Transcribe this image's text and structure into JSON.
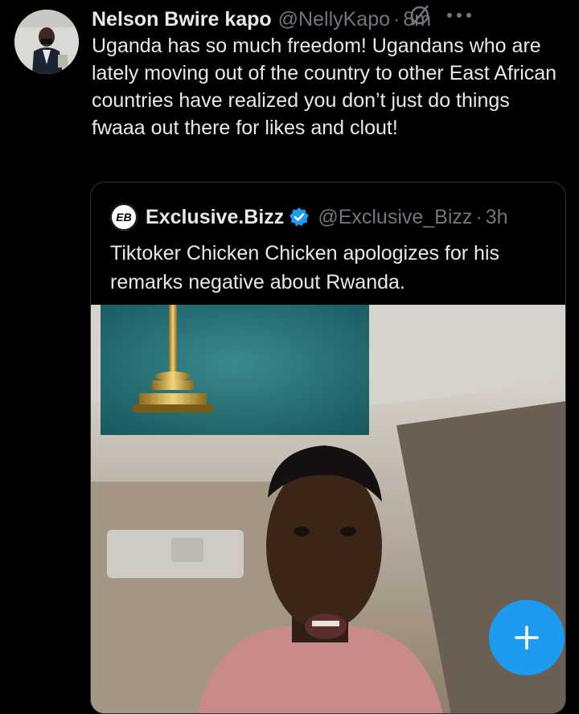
{
  "tweet": {
    "author_name": "Nelson Bwire kapo",
    "handle": "@NellyKapo",
    "separator": "·",
    "time": "8m",
    "text": "Uganda has so much freedom! Ugandans who are lately moving out of the country to other East African countries have realized you don’t just do things fwaaa out there for likes and clout!",
    "avatar_icon": "profile-photo-icon",
    "grok_icon": "grok-icon",
    "more_icon": "more-horizontal-icon"
  },
  "quote": {
    "author_name": "Exclusive.Bizz",
    "handle": "@Exclusive_Bizz",
    "separator": "·",
    "time": "3h",
    "text": "Tiktoker Chicken Chicken apologizes for his remarks negative about Rwanda.",
    "logo_text": "EB",
    "verified_icon": "verified-badge-icon"
  },
  "compose": {
    "icon": "plus-icon"
  },
  "colors": {
    "background": "#000000",
    "text_primary": "#e7e9ea",
    "text_secondary": "#71767b",
    "accent": "#1d9bf0",
    "border": "#2f3336"
  }
}
